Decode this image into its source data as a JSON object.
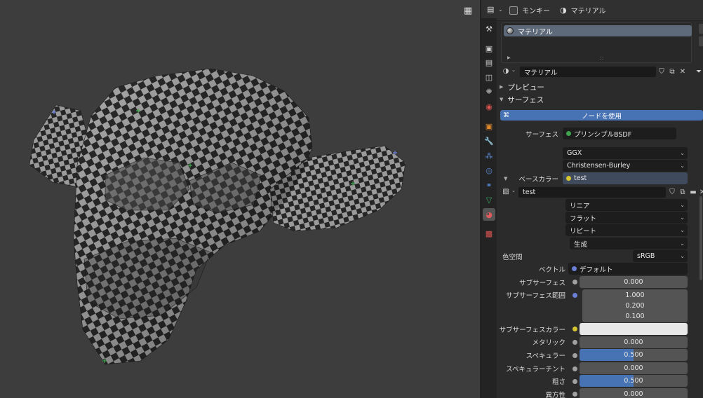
{
  "viewport": {
    "grid_button_icon": "grid-view-icon"
  },
  "header": {
    "object_name": "モンキー",
    "material_name": "マテリアル"
  },
  "material_slots": {
    "items": [
      "マテリアル"
    ]
  },
  "datablock": {
    "name": "マテリアル"
  },
  "panels": {
    "preview": "プレビュー",
    "surface": "サーフェス"
  },
  "use_nodes_label": "ノードを使用",
  "surface": {
    "surface_label": "サーフェス",
    "surface_value": "プリンシプルBSDF",
    "distribution": "GGX",
    "subsurface_method": "Christensen-Burley",
    "base_color_label": "ベースカラー",
    "base_color_value": "test",
    "image_name": "test",
    "interpolation": "リニア",
    "projection": "フラット",
    "extension": "リピート",
    "source": "生成",
    "color_space_label": "色空間",
    "color_space_value": "sRGB",
    "vector_label": "ベクトル",
    "vector_value": "デフォルト",
    "subsurface_label": "サブサーフェス",
    "subsurface_value": "0.000",
    "subsurface_radius_label": "サブサーフェス範囲",
    "subsurface_radius": [
      "1.000",
      "0.200",
      "0.100"
    ],
    "subsurface_color_label": "サブサーフェスカラー",
    "subsurface_color": "#e8e8e8",
    "metallic_label": "メタリック",
    "metallic_value": "0.000",
    "specular_label": "スペキュラー",
    "specular_value": "0.500",
    "specular_fraction": 0.5,
    "specular_tint_label": "スペキュラーチント",
    "specular_tint_value": "0.000",
    "roughness_label": "粗さ",
    "roughness_value": "0.500",
    "roughness_fraction": 0.5,
    "anisotropic_label": "異方性",
    "anisotropic_value": "0.000"
  },
  "colors": {
    "accent": "#4772b3",
    "socket_green": "#3fa34d",
    "socket_yellow": "#d6c630",
    "socket_blue": "#6a7fd6",
    "socket_gray": "#a1a1a1"
  }
}
